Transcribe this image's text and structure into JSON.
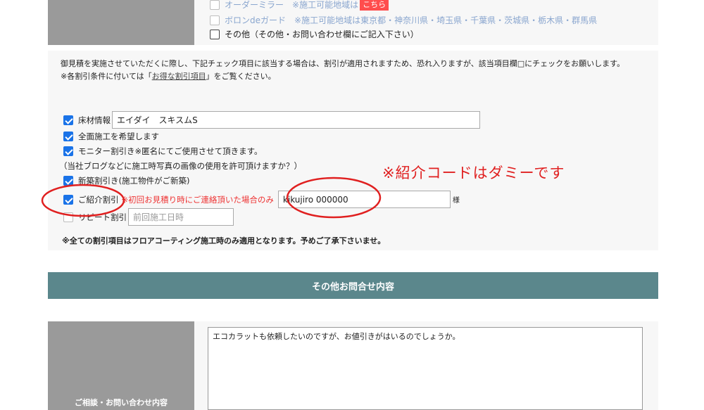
{
  "top_options": [
    {
      "label": "オーダーミラー",
      "note": "※施工可能地域は",
      "badge": "こちら",
      "checked": false
    },
    {
      "label": "ボロンdeガード",
      "note": "※施工可能地域は東京都・神奈川県・埼玉県・千葉県・茨城県・栃木県・群馬県",
      "checked": false
    },
    {
      "label": "その他（その他・お問い合わせ欄にご記入下さい）",
      "checked": false
    }
  ],
  "discount": {
    "intro_line1": "御見積を実施させていただくに際し、下記チェック項目に該当する場合は、割引が適用されますため、恐れ入りますが、該当項目欄□にチェックをお願いします。",
    "intro_line2_prefix": "※各割引条件に付いては「",
    "intro_link": "お得な割引項目",
    "intro_line2_suffix": "」をご覧ください。",
    "floor_label": "床材情報",
    "floor_value": "エイダイ　スキスムS",
    "full_label": "全面施工を希望します",
    "monitor_label": "モニター割引き※匿名にてご使用させて頂きます。",
    "monitor_sub": "（当社ブログなどに施工時写真の画像の使用を許可頂けますか？）",
    "newbuild_label": "新築割引き(施工物件がご新築)",
    "referral_label": "ご紹介割引",
    "referral_note": "※初回お見積り時にご連絡頂いた場合のみ",
    "referral_value": "kikujiro 000000",
    "referral_suffix": "様",
    "repeat_label": "リピート割引",
    "repeat_placeholder": "前回施工日時",
    "bottom_note": "※全ての割引項目はフロアコーティング施工時のみ適用となります。予めご了承下さいませ。"
  },
  "section_title": "その他お問合せ内容",
  "inquiry": {
    "label": "ご相談・お問い合わせ内容",
    "value": "エコカラットも依頼したいのですが、お値引きがはいるのでしょうか。"
  },
  "annotation": {
    "text": "※紹介コードはダミーです",
    "color": "#e02020"
  }
}
